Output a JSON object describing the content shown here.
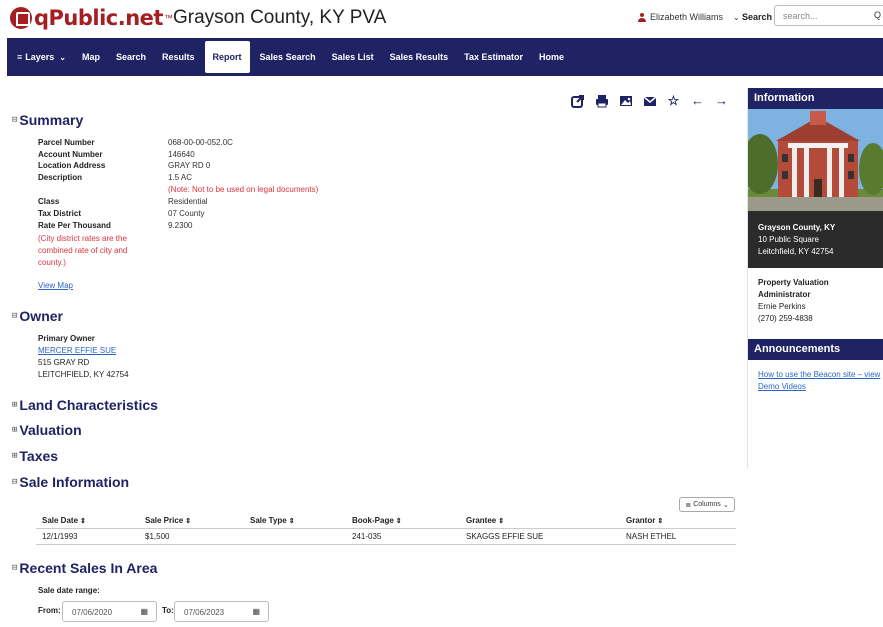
{
  "header": {
    "logo_text": "qPublic.net",
    "logo_tm": "™",
    "site_title": "Grayson County, KY PVA",
    "user_name": "Elizabeth Williams",
    "search_link": "Search",
    "search_placeholder": "search..."
  },
  "nav": {
    "items": [
      {
        "label": "Layers"
      },
      {
        "label": "Map"
      },
      {
        "label": "Search"
      },
      {
        "label": "Results"
      },
      {
        "label": "Report",
        "active": true
      },
      {
        "label": "Sales Search"
      },
      {
        "label": "Sales List"
      },
      {
        "label": "Sales Results"
      },
      {
        "label": "Tax Estimator"
      },
      {
        "label": "Home"
      }
    ]
  },
  "toolbar": {
    "icons": [
      "share-icon",
      "print-icon",
      "image-icon",
      "email-icon",
      "star-icon",
      "arrow-left-icon",
      "arrow-right-icon"
    ]
  },
  "summary": {
    "title": "Summary",
    "rows": [
      {
        "key": "Parcel Number",
        "value": "068-00-00-052.0C"
      },
      {
        "key": "Account Number",
        "value": "146640"
      },
      {
        "key": "Location Address",
        "value": "GRAY RD 0"
      },
      {
        "key": "Description",
        "value": "1.5 AC"
      },
      {
        "key": "",
        "value": "(Note: Not to be used on legal documents)"
      },
      {
        "key": "Class",
        "value": "Residential"
      },
      {
        "key": "Tax District",
        "value": "07 County"
      },
      {
        "key": "Rate Per Thousand",
        "value": "9.2300"
      }
    ],
    "rate_note_1": "(City district rates are the",
    "rate_note_2": "combined rate of city and",
    "rate_note_3": "county.)",
    "view_map": "View Map"
  },
  "owner": {
    "title": "Owner",
    "label": "Primary Owner",
    "name": "MERCER EFFIE SUE",
    "address_1": "515 GRAY RD",
    "address_2": "LEITCHFIELD, KY 42754"
  },
  "sections": {
    "land": "Land Characteristics",
    "valuation": "Valuation",
    "taxes": "Taxes",
    "sale_info": "Sale Information",
    "recent_sales": "Recent Sales In Area"
  },
  "sales_table": {
    "columns_btn": "Columns",
    "headers": [
      "Sale Date",
      "Sale Price",
      "Sale Type",
      "Book-Page",
      "Grantee",
      "Grantor"
    ],
    "rows": [
      [
        "12/1/1993",
        "$1,500",
        "",
        "241-035",
        "SKAGGS EFFIE SUE",
        "NASH ETHEL"
      ]
    ]
  },
  "recent_sales": {
    "range_label": "Sale date range:",
    "from_label": "From:",
    "from_value": "07/06/2020",
    "to_label": "To:",
    "to_value": "07/06/2023"
  },
  "sidebar": {
    "info_title": "Information",
    "county": "Grayson County, KY",
    "street": "10 Public Square",
    "city": "Leitchfield, KY 42754",
    "pva_title_1": "Property Valuation",
    "pva_title_2": "Administrator",
    "pva_name": "Ernie Perkins",
    "pva_phone": "(270) 259-4838",
    "ann_title": "Announcements",
    "ann_link_1": "How to use the Beacon site – view",
    "ann_link_2": "Demo Videos"
  },
  "colors": {
    "brand_red": "#a41e22",
    "nav_blue": "#1f2363",
    "note_red": "#e0333f",
    "link_blue": "#2d64c8"
  }
}
